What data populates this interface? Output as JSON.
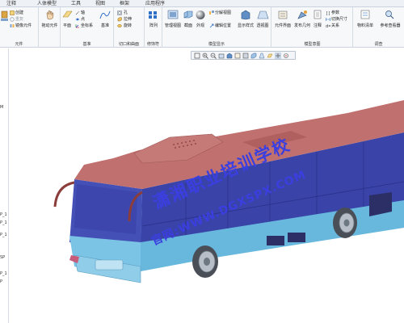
{
  "menu": {
    "tabs": [
      "注释",
      "人体模型",
      "工具",
      "视图",
      "框架",
      "应用程序"
    ]
  },
  "ribbon": {
    "components": {
      "create": "创建",
      "repeat": "重复",
      "mirror": "镜像元件",
      "drag": "拖动元件",
      "label": "元件"
    },
    "datum": {
      "plane": "平面",
      "axis": "轴",
      "point": "点",
      "coord": "坐标系",
      "curve": "基准",
      "label": "基准"
    },
    "cut": {
      "hole": "孔",
      "extrude": "拉伸",
      "revolve": "旋转",
      "label": "切口和曲面"
    },
    "modifiers": {
      "pattern": "阵列",
      "label": "修饰符"
    },
    "model_display": {
      "manage_views": "管理视图",
      "section": "截面",
      "appearance": "外观",
      "explode_view": "分解视图",
      "edit_position": "编辑位置",
      "display_style": "显示样式",
      "perspective": "透视图",
      "label": "模型显示"
    },
    "model_intent": {
      "component_interface": "元件界面",
      "publish_geometry": "发布几何",
      "notes": "注释",
      "parameters": "参数",
      "switch_dimensions": "切换尺寸",
      "relations": "关系",
      "label": "模型意图"
    },
    "investigate": {
      "bom": "物料清单",
      "reference_viewer": "参考查看器",
      "label": "调查"
    }
  },
  "left_strip": [
    "M",
    "P_1",
    "P_1",
    "P_1",
    "SP",
    "P_1",
    "P"
  ],
  "watermark": {
    "line1": "潇湘职业培训学校",
    "line2": "官网:WWW.DGXSPX.COM"
  },
  "colors": {
    "roof": "#c0706e",
    "body_blue": "#3a43a8",
    "skirt": "#68b8de",
    "watermark": "#3b3fe0"
  }
}
